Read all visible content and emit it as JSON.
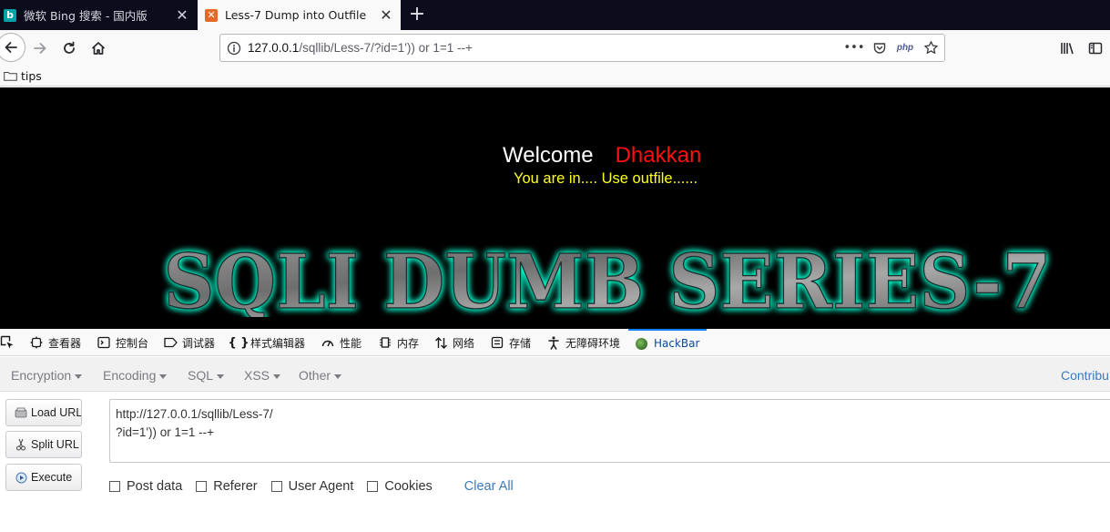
{
  "tabs": [
    {
      "title": "微软 Bing 搜索 - 国内版",
      "icon": "bing-icon"
    },
    {
      "title": "Less-7 Dump into Outfile",
      "icon": "xampp-icon"
    }
  ],
  "nav": {
    "url_host": "127.0.0.1",
    "url_path": "/sqllib/Less-7/?id=1')) or 1=1 --+",
    "php_badge": "php"
  },
  "bookmarks": [
    {
      "label": "tips"
    }
  ],
  "page": {
    "welcome": "Welcome",
    "name": "Dhakkan",
    "message": "You are in.... Use outfile......",
    "banner": "SQLI DUMB SERIES-7"
  },
  "devtools": {
    "tabs": [
      {
        "label": "查看器",
        "icon": "inspector-icon"
      },
      {
        "label": "控制台",
        "icon": "console-icon"
      },
      {
        "label": "调试器",
        "icon": "debugger-icon"
      },
      {
        "label": "样式编辑器",
        "icon": "style-editor-icon"
      },
      {
        "label": "性能",
        "icon": "performance-icon"
      },
      {
        "label": "内存",
        "icon": "memory-icon"
      },
      {
        "label": "网络",
        "icon": "network-icon"
      },
      {
        "label": "存储",
        "icon": "storage-icon"
      },
      {
        "label": "无障碍环境",
        "icon": "accessibility-icon"
      },
      {
        "label": "HackBar",
        "icon": "hackbar-icon",
        "active": true
      }
    ]
  },
  "hackbar": {
    "menu": [
      "Encryption",
      "Encoding",
      "SQL",
      "XSS",
      "Other"
    ],
    "contribute": "Contribu",
    "buttons": [
      "Load URL",
      "Split URL",
      "Execute"
    ],
    "url_line1": "http://127.0.0.1/sqllib/Less-7/",
    "url_line2": "?id=1')) or 1=1 --+",
    "checkboxes": [
      "Post data",
      "Referer",
      "User Agent",
      "Cookies"
    ],
    "clear_all": "Clear All"
  },
  "colors": {
    "tabstrip_bg": "#0c0c1d",
    "page_bg": "#000000",
    "welcome": "#ffffff",
    "name": "#ff1010",
    "message": "#ffff22",
    "banner_glow": "#00ffd0",
    "hackbar_link": "#3a7ac0"
  }
}
